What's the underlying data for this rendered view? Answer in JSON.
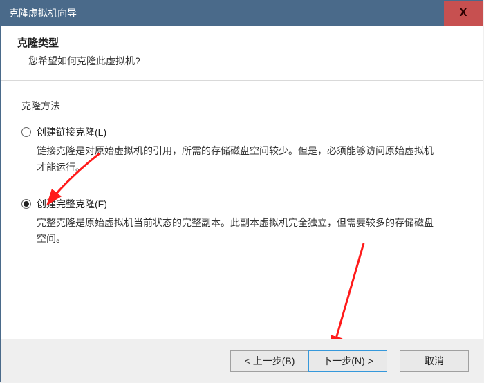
{
  "titlebar": {
    "title": "克隆虚拟机向导",
    "close": "X"
  },
  "header": {
    "title": "克隆类型",
    "subtitle": "您希望如何克隆此虚拟机?"
  },
  "group": {
    "label": "克隆方法",
    "options": [
      {
        "label": "创建链接克隆(L)",
        "desc": "链接克隆是对原始虚拟机的引用，所需的存储磁盘空间较少。但是，必须能够访问原始虚拟机才能运行。",
        "checked": false
      },
      {
        "label": "创建完整克隆(F)",
        "desc": "完整克隆是原始虚拟机当前状态的完整副本。此副本虚拟机完全独立，但需要较多的存储磁盘空间。",
        "checked": true
      }
    ]
  },
  "footer": {
    "back": "< 上一步(B)",
    "next": "下一步(N) >",
    "cancel": "取消"
  }
}
